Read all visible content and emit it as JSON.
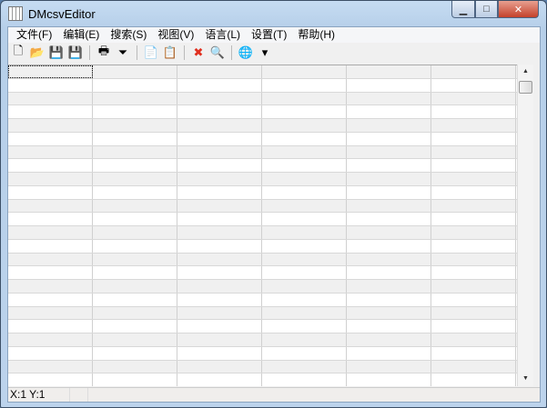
{
  "window": {
    "title": "DMcsvEditor"
  },
  "menu": [
    "文件(F)",
    "编辑(E)",
    "搜索(S)",
    "视图(V)",
    "语言(L)",
    "设置(T)",
    "帮助(H)"
  ],
  "toolbar": [
    {
      "name": "new-icon",
      "glyph": "🗋"
    },
    {
      "name": "open-icon",
      "glyph": "📂"
    },
    {
      "name": "save-icon",
      "glyph": "💾"
    },
    {
      "name": "save-as-icon",
      "glyph": "💾"
    },
    {
      "sep": true
    },
    {
      "name": "print-icon",
      "glyph": "🖶"
    },
    {
      "name": "filter-icon",
      "glyph": "⏷"
    },
    {
      "sep": true
    },
    {
      "name": "copy-icon",
      "glyph": "📄"
    },
    {
      "name": "paste-icon",
      "glyph": "📋"
    },
    {
      "sep": true
    },
    {
      "name": "delete-icon",
      "glyph": "✖",
      "color": "#e03020"
    },
    {
      "name": "search-icon",
      "glyph": "🔍"
    },
    {
      "sep": true
    },
    {
      "name": "globe-icon",
      "glyph": "🌐"
    },
    {
      "name": "dropdown-icon",
      "glyph": "▾"
    }
  ],
  "status": {
    "position": "X:1  Y:1"
  }
}
